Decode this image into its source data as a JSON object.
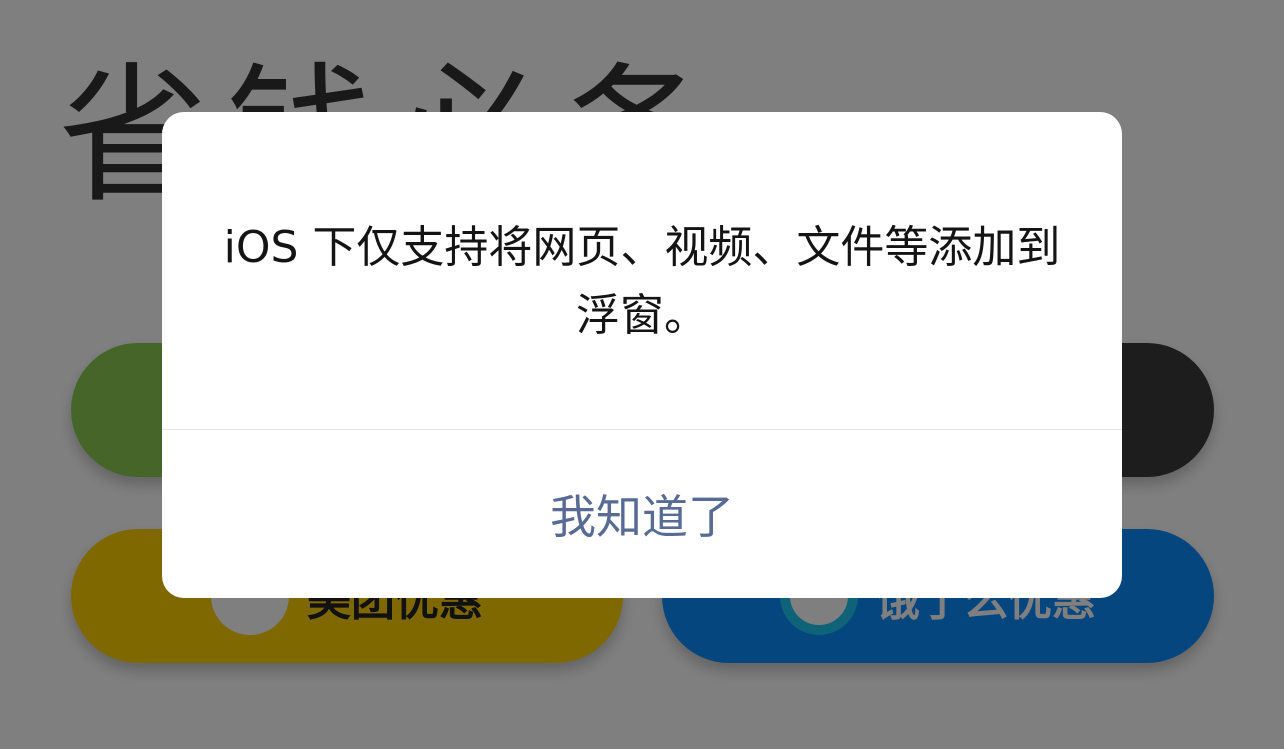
{
  "page": {
    "title": "省钱必备"
  },
  "coupons": [
    {
      "label": "",
      "color": "#8ccd52"
    },
    {
      "label": "",
      "color": "#3a3a3a"
    },
    {
      "label": "美团优惠",
      "color": "#ffd000",
      "icon": "meituan-logo-icon"
    },
    {
      "label": "饿了么优惠",
      "color": "#0a8dff",
      "icon": "eleme-logo-icon"
    }
  ],
  "dialog": {
    "message": "iOS 下仅支持将网页、视频、文件等添加到浮窗。",
    "confirm_label": "我知道了",
    "confirm_color": "#576b95"
  }
}
